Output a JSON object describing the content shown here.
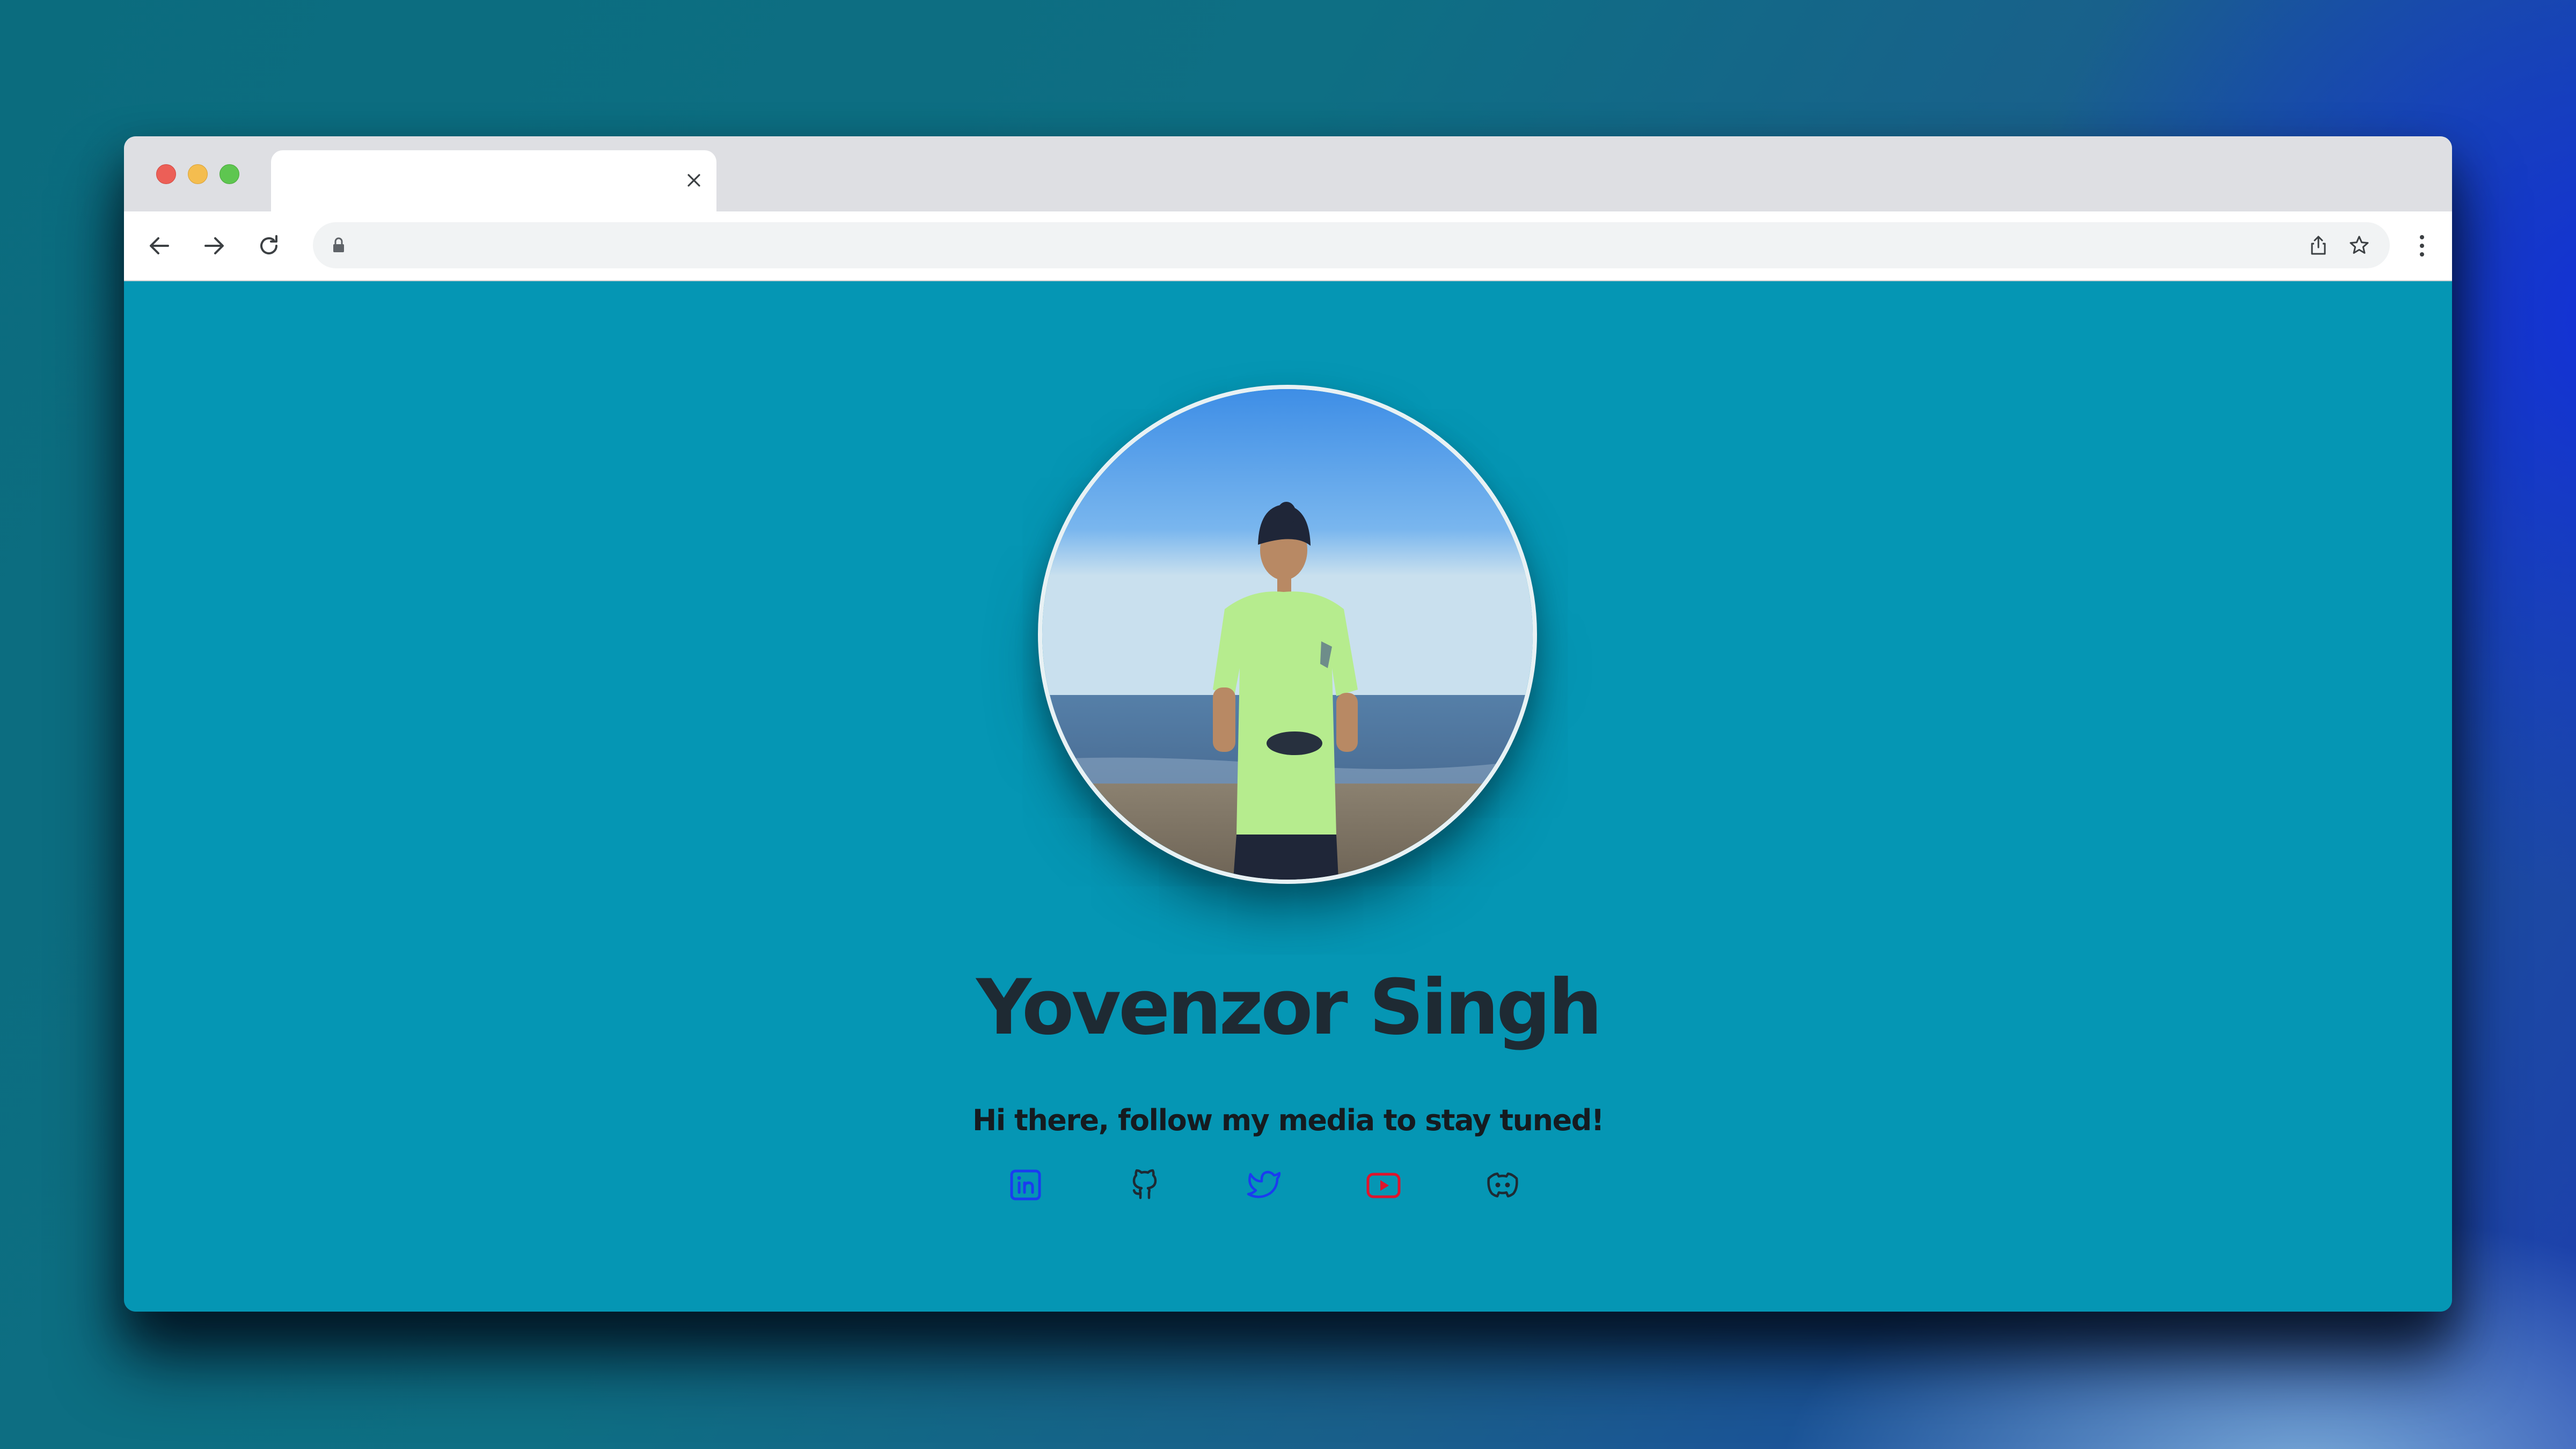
{
  "browser": {
    "tab_title": "",
    "address": "",
    "icons": [
      "back-icon",
      "forward-icon",
      "reload-icon",
      "lock-icon",
      "share-icon",
      "bookmark-star-icon",
      "more-menu-icon",
      "close-icon"
    ]
  },
  "profile": {
    "name": "Yovenzor Singh",
    "tagline": "Hi there, follow my media to stay tuned!",
    "avatar_icon": "profile-photo"
  },
  "social_links": [
    {
      "name": "linkedin-icon",
      "color": "#1a3cf0"
    },
    {
      "name": "github-icon",
      "color": "#1e2a33"
    },
    {
      "name": "twitter-icon",
      "color": "#1a3cf0"
    },
    {
      "name": "youtube-icon",
      "color": "#e0142c"
    },
    {
      "name": "discord-icon",
      "color": "#1e2a33"
    }
  ],
  "colors": {
    "page_background": "#0596b4",
    "tab_strip": "#dedfe3",
    "title_text": "#1e2a33"
  }
}
